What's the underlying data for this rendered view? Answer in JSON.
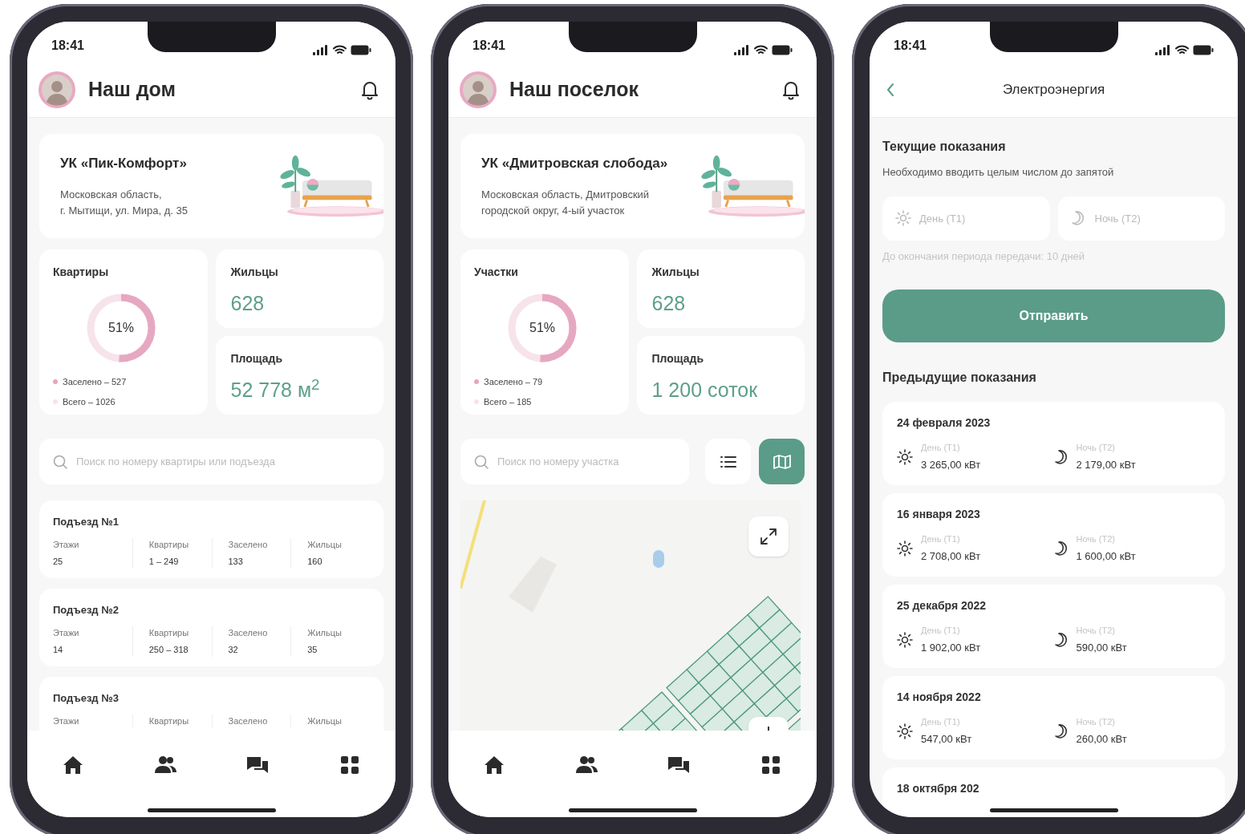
{
  "phones": [
    {
      "kind": "overview",
      "status_time": "18:41",
      "header": {
        "kind": "profile",
        "title": "Наш дом"
      },
      "company": {
        "name": "УК «Пик-Комфорт»",
        "address": [
          "Московская область,",
          "г. Мытищи, ул. Мира, д. 35"
        ]
      },
      "occupancy": {
        "title": "Квартиры",
        "percent": "51%",
        "level": 0.51,
        "legend": [
          {
            "label": "Заселено – 527",
            "color": "#e8a4bf"
          },
          {
            "label": "Всего – 1026",
            "color": "#f7e3eb"
          }
        ]
      },
      "stats": [
        {
          "label": "Жильцы",
          "value": "628"
        },
        {
          "label": "Площадь",
          "value": "52 778 м$^{2}$"
        }
      ],
      "search": {
        "placeholder": "Поиск по номеру квартиры или подъезда"
      },
      "content": {
        "kind": "entrances",
        "items": [
          {
            "title": "Подъезд №1",
            "fields": [
              {
                "label": "Этажи",
                "value": "25"
              },
              {
                "label": "Квартиры",
                "value": "1 – 249"
              },
              {
                "label": "Заселено",
                "value": "133"
              },
              {
                "label": "Жильцы",
                "value": "160"
              }
            ]
          },
          {
            "title": "Подъезд №2",
            "fields": [
              {
                "label": "Этажи",
                "value": "14"
              },
              {
                "label": "Квартиры",
                "value": "250 – 318"
              },
              {
                "label": "Заселено",
                "value": "32"
              },
              {
                "label": "Жильцы",
                "value": "35"
              }
            ]
          },
          {
            "title": "Подъезд №3",
            "fields": [
              {
                "label": "Этажи"
              },
              {
                "label": "Квартиры"
              },
              {
                "label": "Заселено"
              },
              {
                "label": "Жильцы"
              }
            ]
          }
        ]
      },
      "tabbar": [
        {
          "kind": "home"
        },
        {
          "kind": "people"
        },
        {
          "kind": "chat"
        },
        {
          "kind": "grid"
        }
      ]
    },
    {
      "kind": "overview",
      "status_time": "18:41",
      "header": {
        "kind": "profile",
        "title": "Наш поселок"
      },
      "company": {
        "name": "УК «Дмитровская слобода»",
        "address": [
          "Московская область, Дмитровский",
          "городской округ, 4-ый участок"
        ]
      },
      "occupancy": {
        "title": "Участки",
        "percent": "51%",
        "level": 0.51,
        "legend": [
          {
            "label": "Заселено – 79",
            "color": "#e8a4bf"
          },
          {
            "label": "Всего – 185",
            "color": "#f7e3eb"
          }
        ]
      },
      "stats": [
        {
          "label": "Жильцы",
          "value": "628"
        },
        {
          "label": "Площадь",
          "value": "1 200 соток"
        }
      ],
      "search": {
        "placeholder": "Поиск по номеру участка"
      },
      "view_toggle": [
        {
          "kind": "list",
          "selected": false
        },
        {
          "kind": "map",
          "selected": true
        }
      ],
      "content": {
        "kind": "map"
      },
      "tabbar": [
        {
          "kind": "home"
        },
        {
          "kind": "people"
        },
        {
          "kind": "chat"
        },
        {
          "kind": "grid"
        }
      ]
    },
    {
      "kind": "readings",
      "status_time": "18:41",
      "header": {
        "kind": "back",
        "title": "Электроэнергия"
      },
      "current": {
        "title": "Текущие показания",
        "hint": "Необходимо вводить целым числом до запятой",
        "inputs": [
          {
            "kind": "day",
            "placeholder": "День (Т1)"
          },
          {
            "kind": "night",
            "placeholder": "Ночь (Т2)"
          }
        ],
        "deadline": "До окончания периода передачи: 10 дней",
        "button": "Отправить"
      },
      "previous": {
        "title": "Предыдущие показания",
        "items": [
          {
            "date": "24 февраля 2023",
            "readings": [
              {
                "kind": "day",
                "label": "День (Т1)",
                "value": "3 265,00 кВт"
              },
              {
                "kind": "night",
                "label": "Ночь (Т2)",
                "value": "2 179,00 кВт"
              }
            ]
          },
          {
            "date": "16 января 2023",
            "readings": [
              {
                "kind": "day",
                "label": "День (Т1)",
                "value": "2 708,00 кВт"
              },
              {
                "kind": "night",
                "label": "Ночь (Т2)",
                "value": "1 600,00 кВт"
              }
            ]
          },
          {
            "date": "25 декабря 2022",
            "readings": [
              {
                "kind": "day",
                "label": "День (Т1)",
                "value": "1 902,00 кВт"
              },
              {
                "kind": "night",
                "label": "Ночь (Т2)",
                "value": "590,00 кВт"
              }
            ]
          },
          {
            "date": "14 ноября 2022",
            "readings": [
              {
                "kind": "day",
                "label": "День (Т1)",
                "value": "547,00 кВт"
              },
              {
                "kind": "night",
                "label": "Ночь (Т2)",
                "value": "260,00 кВт"
              }
            ]
          },
          {
            "date": "18 октября 202"
          }
        ]
      }
    }
  ]
}
